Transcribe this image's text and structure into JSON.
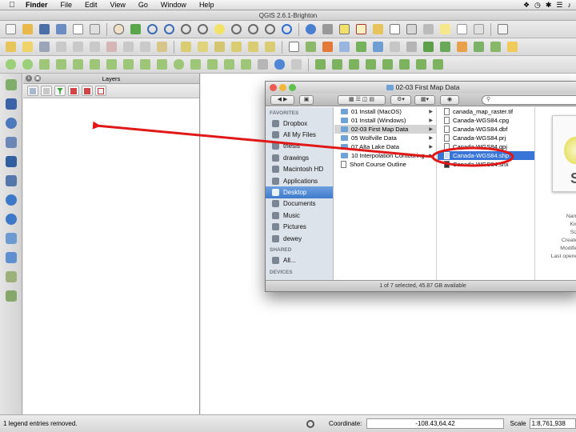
{
  "menubar": {
    "apple": "",
    "items": [
      "Finder",
      "File",
      "Edit",
      "View",
      "Go",
      "Window",
      "Help"
    ]
  },
  "app": {
    "title": "QGIS 2.6.1-Brighton"
  },
  "layers_panel": {
    "title": "Layers"
  },
  "status": {
    "message": "1 legend entries removed.",
    "coordinate_label": "Coordinate:",
    "coordinate_value": "-108.43,64.42",
    "scale_label": "Scale",
    "scale_value": "1:8,761,938"
  },
  "finder": {
    "title": "02-03 First Map Data",
    "search_placeholder": "",
    "sidebar": {
      "favorites_label": "FAVORITES",
      "favorites": [
        "Dropbox",
        "All My Files",
        "thesis",
        "drawings",
        "Macintosh HD",
        "Applications",
        "Desktop",
        "Documents",
        "Music",
        "Pictures",
        "dewey"
      ],
      "selected": "Desktop",
      "shared_label": "SHARED",
      "shared": [
        "All..."
      ],
      "devices_label": "DEVICES"
    },
    "column1": [
      "01 Install (MacOS)",
      "01 Install (Windows)",
      "02-03 First Map Data",
      "05 Wolfville Data",
      "07 Alta Lake Data",
      "10 Interpolation Contouring",
      "Short Course Outline"
    ],
    "column2": [
      "canada_map_raster.tif",
      "Canada-WGS84.cpg",
      "Canada-WGS84.dbf",
      "Canada-WGS84.prj",
      "Canada-WGS84.qpj",
      "Canada-WGS84.shp",
      "Canada-WGS84.shx"
    ],
    "selected_file": "Canada-WGS84.shp",
    "preview_letter": "S",
    "meta_labels": [
      "Name",
      "Kind",
      "Size",
      "Created",
      "Modified",
      "Last opened"
    ],
    "status": "1 of 7 selected, 45.87 GB available"
  },
  "annotation": {
    "color": "#e01818"
  }
}
